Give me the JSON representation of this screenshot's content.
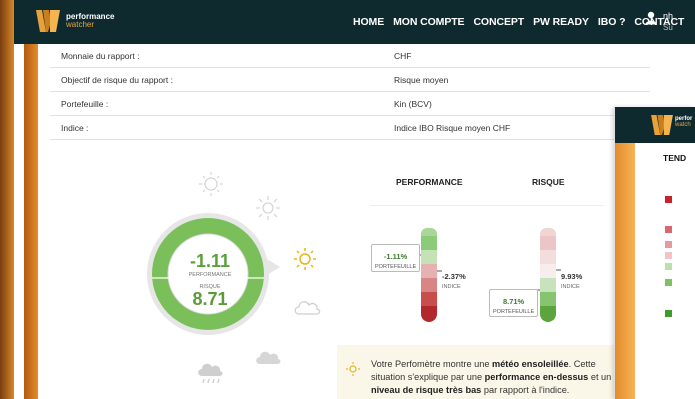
{
  "brand": {
    "name": "performance",
    "sub": "watcher",
    "accent": "#e7a23a",
    "navbar_color": "#0f2a2f"
  },
  "nav": {
    "items": [
      "HOME",
      "MON COMPTE",
      "CONCEPT",
      "PW READY",
      "IBO ?",
      "CONTACT"
    ]
  },
  "user": {
    "name": "nh",
    "sub": "Su"
  },
  "report_info": [
    {
      "label": "Monnaie du rapport :",
      "value": "CHF"
    },
    {
      "label": "Objectif de risque du rapport :",
      "value": "Risque moyen"
    },
    {
      "label": "Portefeuille :",
      "value": "Kin (BCV)"
    },
    {
      "label": "Indice :",
      "value": "Indice IBO Risque moyen CHF"
    }
  ],
  "gauge": {
    "performance_value": "-1.11",
    "performance_label": "PERFORMANCE",
    "risk_label": "RISQUE",
    "risk_value": "8.71",
    "ring_color": "#7bbf5a",
    "risk_color": "#5a9b38"
  },
  "thermometers": {
    "performance_title": "PERFORMANCE",
    "risk_title": "RISQUE",
    "performance": {
      "portfolio_value": "-1.11%",
      "portfolio_label": "PORTEFEUILLE",
      "index_value": "-2.37%",
      "index_label": "INDICE"
    },
    "risk": {
      "index_value": "9.93%",
      "index_label": "INDICE",
      "portfolio_value": "8.71%",
      "portfolio_label": "PORTEFEUILLE"
    }
  },
  "message": {
    "part1": "Votre Perfomètre montre une ",
    "bold1": "météo ensoleillée",
    "part2": ". Cette situation s'explique par une ",
    "bold2": "performance en-dessus",
    "part3": " et un ",
    "bold3": "niveau de risque très bas",
    "part4": " par rapport à l'indice."
  },
  "second_window": {
    "title": "TEND",
    "logo_name": "perfor",
    "logo_sub": "watch"
  },
  "icons": [
    "logo-icon",
    "user-icon",
    "sun-icon",
    "cloud-icon",
    "rain-cloud-icon",
    "snow-cloud-icon"
  ]
}
